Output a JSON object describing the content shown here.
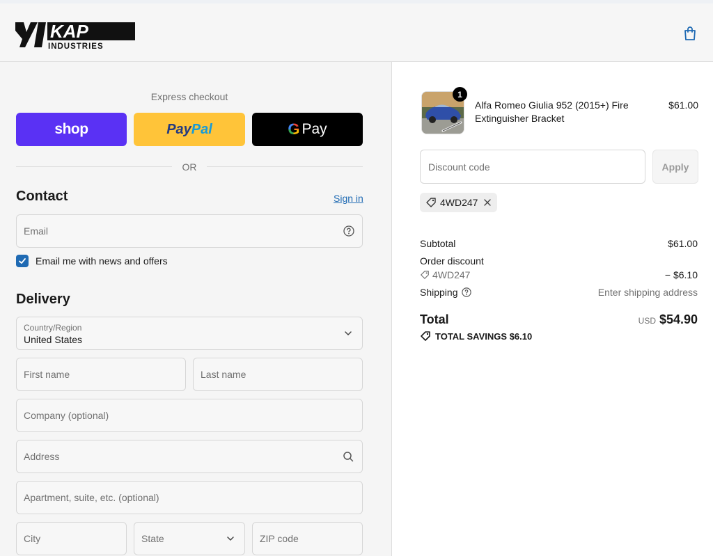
{
  "header": {
    "brand_primary": "KAP",
    "brand_secondary": "INDUSTRIES",
    "cart_icon": "shopping-bag-icon"
  },
  "express": {
    "title": "Express checkout",
    "shop_label": "shop",
    "paypal_label_a": "Pay",
    "paypal_label_b": "Pal",
    "gpay_g": "G",
    "gpay_label": "Pay",
    "or_label": "OR"
  },
  "contact": {
    "heading": "Contact",
    "signin_label": "Sign in",
    "email_placeholder": "Email",
    "newsletter_label": "Email me with news and offers",
    "newsletter_checked": true
  },
  "delivery": {
    "heading": "Delivery",
    "country_label": "Country/Region",
    "country_value": "United States",
    "first_name_placeholder": "First name",
    "last_name_placeholder": "Last name",
    "company_placeholder": "Company (optional)",
    "address_placeholder": "Address",
    "apartment_placeholder": "Apartment, suite, etc. (optional)",
    "city_placeholder": "City",
    "state_placeholder": "State",
    "zip_placeholder": "ZIP code"
  },
  "order": {
    "item": {
      "name": "Alfa Romeo Giulia 952 (2015+) Fire Extinguisher Bracket",
      "price": "$61.00",
      "quantity": "1"
    },
    "discount_placeholder": "Discount code",
    "apply_label": "Apply",
    "applied_code": "4WD247",
    "subtotal_label": "Subtotal",
    "subtotal_value": "$61.00",
    "order_discount_label": "Order discount",
    "order_discount_code": "4WD247",
    "order_discount_value": "− $6.10",
    "shipping_label": "Shipping",
    "shipping_value": "Enter shipping address",
    "total_label": "Total",
    "total_currency": "USD",
    "total_value": "$54.90",
    "savings_label": "TOTAL SAVINGS",
    "savings_value": "$6.10"
  },
  "colors": {
    "accent": "#1f6ab3",
    "shop": "#5a31f4",
    "paypal": "#ffc439",
    "gpay": "#000000"
  }
}
